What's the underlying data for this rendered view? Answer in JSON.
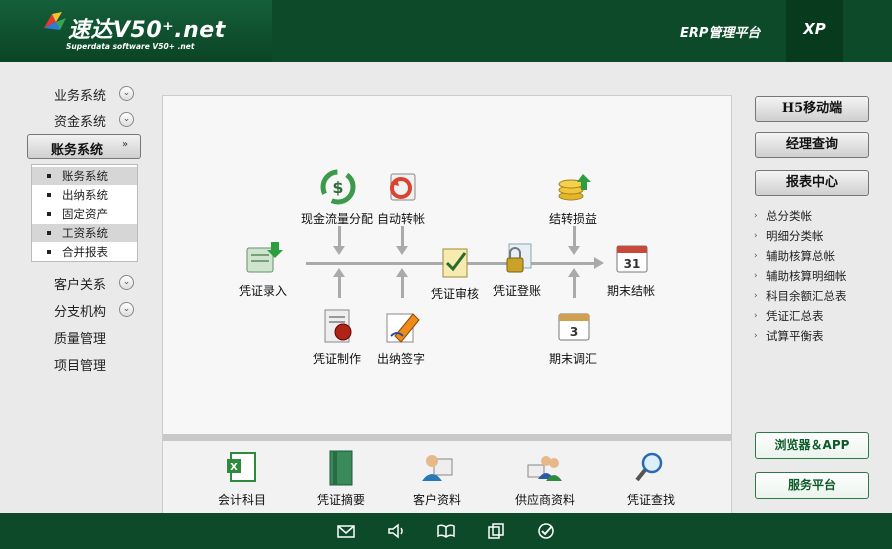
{
  "header": {
    "logo_title": "速达V50⁺.net",
    "logo_subtitle": "Superdata software V50+ .net",
    "platform_label": "ERP管理平台",
    "edition_label": "XP"
  },
  "left_nav": {
    "items_top": [
      "业务系统",
      "资金系统"
    ],
    "active": "账务系统",
    "sub_items": [
      "账务系统",
      "出纳系统",
      "固定资产",
      "工资系统",
      "合并报表"
    ],
    "selected_sub": [
      "账务系统",
      "工资系统"
    ],
    "items_bottom": [
      "客户关系",
      "分支机构",
      "质量管理",
      "项目管理"
    ]
  },
  "flow": {
    "voucher_entry": "凭证录入",
    "cash_flow": "现金流量分配",
    "auto_transfer": "自动转帐",
    "voucher_audit": "凭证审核",
    "voucher_post": "凭证登账",
    "carry_profit": "结转损益",
    "period_close": "期末结帐",
    "voucher_make": "凭证制作",
    "cashier_sign": "出纳签字",
    "period_adjust": "期末调汇"
  },
  "quick_links": [
    "会计科目",
    "凭证摘要",
    "客户资料",
    "供应商资料",
    "凭证查找"
  ],
  "right_panel": {
    "buttons": [
      "H5移动端",
      "经理查询",
      "报表中心"
    ],
    "reports": [
      "总分类帐",
      "明细分类帐",
      "辅助核算总帐",
      "辅助核算明细帐",
      "科目余额汇总表",
      "凭证汇总表",
      "试算平衡表"
    ],
    "browser_app": "浏览器＆APP",
    "service_platform": "服务平台"
  },
  "footer_icons": [
    "mail-icon",
    "speaker-icon",
    "book-icon",
    "documents-icon",
    "check-icon"
  ],
  "colors": {
    "brand_green": "#0d4a2a",
    "panel_gray": "#eaeaea"
  }
}
